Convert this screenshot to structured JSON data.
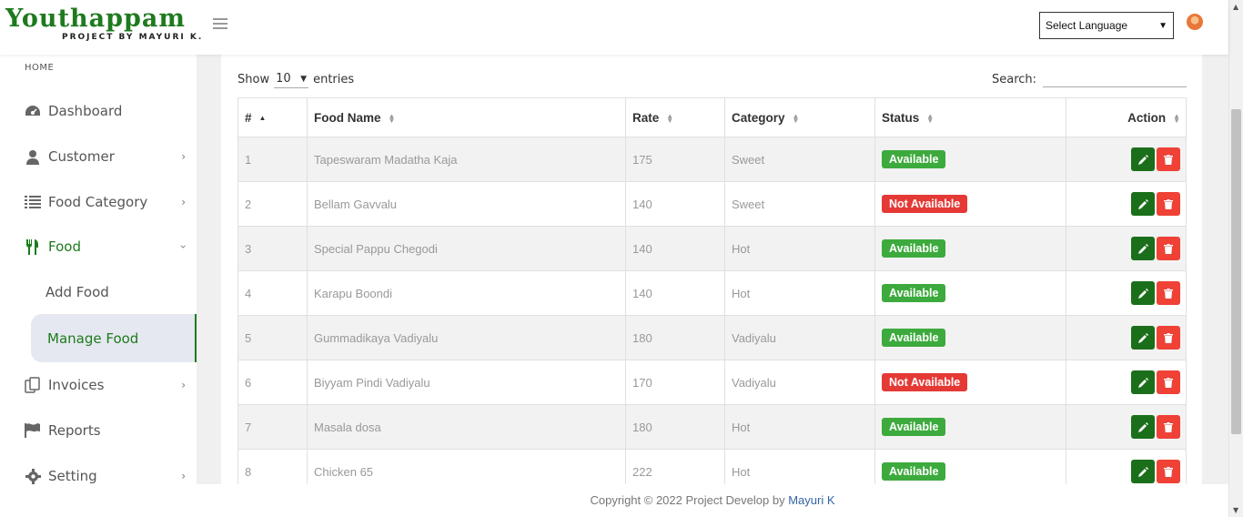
{
  "header": {
    "logo_title": "Youthappam",
    "logo_sub": "PROJECT BY MAYURI K.",
    "language_select": "Select Language"
  },
  "sidebar": {
    "home_label": "HOME",
    "items": [
      {
        "label": "Dashboard",
        "icon": "dashboard-icon"
      },
      {
        "label": "Customer",
        "icon": "user-icon"
      },
      {
        "label": "Food Category",
        "icon": "list-icon"
      },
      {
        "label": "Food",
        "icon": "cutlery-icon"
      },
      {
        "label": "Invoices",
        "icon": "copy-icon"
      },
      {
        "label": "Reports",
        "icon": "flag-icon"
      },
      {
        "label": "Setting",
        "icon": "gear-icon"
      }
    ],
    "sub_items": [
      "Add Food",
      "Manage Food"
    ]
  },
  "table_controls": {
    "show_label": "Show",
    "entries_value": "10",
    "entries_label": "entries",
    "search_label": "Search:"
  },
  "table": {
    "headers": [
      "#",
      "Food Name",
      "Rate",
      "Category",
      "Status",
      "Action"
    ],
    "rows": [
      {
        "id": "1",
        "name": "Tapeswaram Madatha Kaja",
        "rate": "175",
        "category": "Sweet",
        "status": "Available"
      },
      {
        "id": "2",
        "name": "Bellam Gavvalu",
        "rate": "140",
        "category": "Sweet",
        "status": "Not Available"
      },
      {
        "id": "3",
        "name": "Special Pappu Chegodi",
        "rate": "140",
        "category": "Hot",
        "status": "Available"
      },
      {
        "id": "4",
        "name": "Karapu Boondi",
        "rate": "140",
        "category": "Hot",
        "status": "Available"
      },
      {
        "id": "5",
        "name": "Gummadikaya Vadiyalu",
        "rate": "180",
        "category": "Vadiyalu",
        "status": "Available"
      },
      {
        "id": "6",
        "name": "Biyyam Pindi Vadiyalu",
        "rate": "170",
        "category": "Vadiyalu",
        "status": "Not Available"
      },
      {
        "id": "7",
        "name": "Masala dosa",
        "rate": "180",
        "category": "Hot",
        "status": "Available"
      },
      {
        "id": "8",
        "name": "Chicken 65",
        "rate": "222",
        "category": "Hot",
        "status": "Available"
      }
    ]
  },
  "footer": {
    "text": "Copyright © 2022 Project Develop by ",
    "link": "Mayuri K"
  },
  "colors": {
    "brand": "#1e7a1e",
    "available": "#3daa3d",
    "not_available": "#e53935",
    "edit": "#1b6f1b",
    "delete": "#ef4136"
  }
}
